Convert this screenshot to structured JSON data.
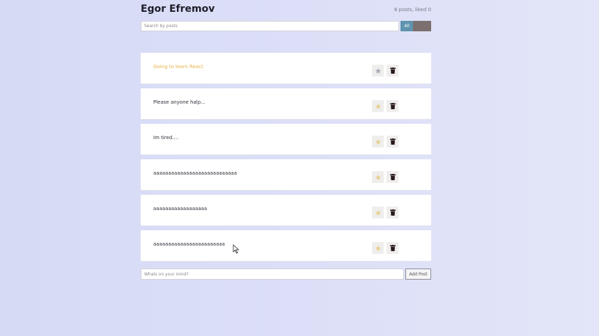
{
  "header": {
    "title": "Egor Efremov",
    "stats": "6 posts, liked 0"
  },
  "search": {
    "placeholder": "Search by posts",
    "filters": [
      {
        "label": "All",
        "color": "#5f93ae"
      },
      {
        "label": "",
        "color": "#7b6f6f"
      }
    ]
  },
  "posts": [
    {
      "text": "Going to learn React",
      "important": true
    },
    {
      "text": "Please anyone halp...",
      "important": false
    },
    {
      "text": "Im tired....",
      "important": false
    },
    {
      "text": "aaaaaaaaaaaaaaaaaaaaaaaaaaaa",
      "important": false
    },
    {
      "text": "aaaaaaaaaaaaaaaaaa",
      "important": false
    },
    {
      "text": "aaaaaaaaaaaaaaaaaaaaaaaa",
      "important": false
    }
  ],
  "add_form": {
    "placeholder": "Whats on your mind?",
    "button_label": "Add Post"
  },
  "colors": {
    "important_text": "#e7b34a",
    "star_active": "#a8a8b8",
    "star_inactive": "#e9cf95",
    "trash": "#2a1a1c"
  },
  "icons": {
    "like": "star-icon",
    "delete": "trash-icon"
  }
}
